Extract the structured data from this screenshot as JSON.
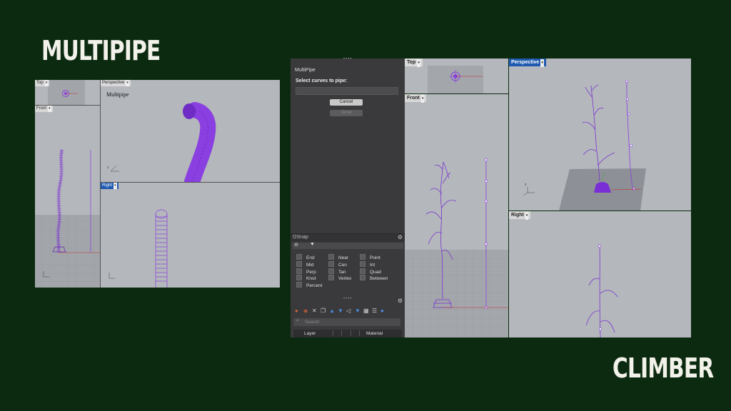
{
  "slide": {
    "title_left": "MULTIPIPE",
    "title_right": "CLIMBER",
    "background": "#0c2a10",
    "accent_purple": "#8a3fe0"
  },
  "left_screenshot": {
    "viewports": {
      "top": {
        "label": "Top"
      },
      "perspective": {
        "label": "Perspective",
        "overlay_text": "Multipipe"
      },
      "front": {
        "label": "Front"
      },
      "right": {
        "label": "Right"
      }
    }
  },
  "right_screenshot": {
    "panel": {
      "command_title": "MultiPipe",
      "prompt": "Select curves to pipe:",
      "input_value": "",
      "cancel_label": "Cancel",
      "done_label": "Done",
      "osnap_title": "OSnap",
      "osnap_options": [
        [
          "End",
          "Near",
          "Point"
        ],
        [
          "Mid",
          "Cen",
          "Int"
        ],
        [
          "Perp",
          "Tan",
          "Quad"
        ],
        [
          "Knot",
          "Vertex",
          "Between"
        ],
        [
          "Percent"
        ]
      ],
      "search_placeholder": "Search",
      "layer_col": "Layer",
      "material_col": "Material"
    },
    "viewports": {
      "top": {
        "label": "Top"
      },
      "front": {
        "label": "Front"
      },
      "perspective": {
        "label": "Perspective"
      },
      "right": {
        "label": "Right"
      }
    }
  }
}
